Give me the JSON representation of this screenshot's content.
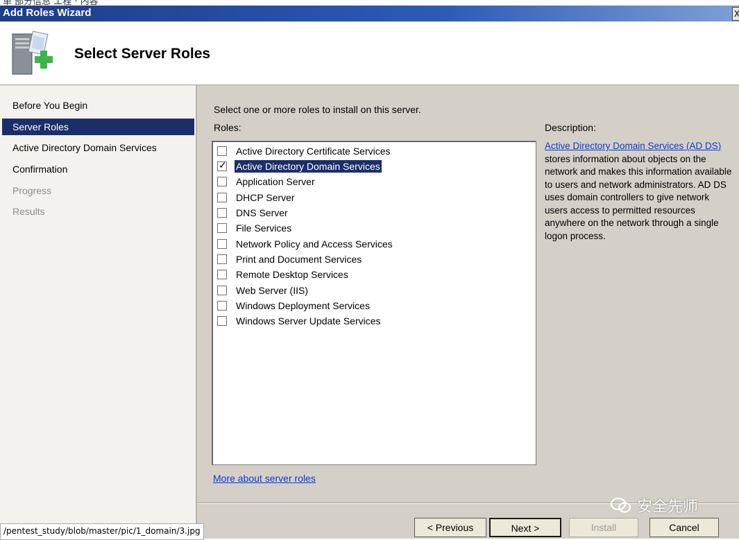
{
  "top_strip_text": "单 部分信息 工程 · 内容",
  "window": {
    "title": "Add Roles Wizard",
    "close_glyph": "X"
  },
  "header": {
    "heading": "Select Server Roles"
  },
  "nav": {
    "items": [
      {
        "label": "Before You Begin",
        "state": "normal"
      },
      {
        "label": "Server Roles",
        "state": "selected"
      },
      {
        "label": "Active Directory Domain Services",
        "state": "normal"
      },
      {
        "label": "Confirmation",
        "state": "normal"
      },
      {
        "label": "Progress",
        "state": "disabled"
      },
      {
        "label": "Results",
        "state": "disabled"
      }
    ]
  },
  "main": {
    "intro": "Select one or more roles to install on this server.",
    "roles_label": "Roles:",
    "description_label": "Description:",
    "roles": [
      {
        "label": "Active Directory Certificate Services",
        "checked": false,
        "selected": false
      },
      {
        "label": "Active Directory Domain Services",
        "checked": true,
        "selected": true
      },
      {
        "label": "Application Server",
        "checked": false,
        "selected": false
      },
      {
        "label": "DHCP Server",
        "checked": false,
        "selected": false
      },
      {
        "label": "DNS Server",
        "checked": false,
        "selected": false
      },
      {
        "label": "File Services",
        "checked": false,
        "selected": false
      },
      {
        "label": "Network Policy and Access Services",
        "checked": false,
        "selected": false
      },
      {
        "label": "Print and Document Services",
        "checked": false,
        "selected": false
      },
      {
        "label": "Remote Desktop Services",
        "checked": false,
        "selected": false
      },
      {
        "label": "Web Server (IIS)",
        "checked": false,
        "selected": false
      },
      {
        "label": "Windows Deployment Services",
        "checked": false,
        "selected": false
      },
      {
        "label": "Windows Server Update Services",
        "checked": false,
        "selected": false
      }
    ],
    "description": {
      "link_text": "Active Directory Domain Services (AD DS)",
      "body": " stores information about objects on the network and makes this information available to users and network administrators. AD DS uses domain controllers to give network users access to permitted resources anywhere on the network through a single logon process."
    },
    "more_link": "More about server roles"
  },
  "buttons": {
    "previous": "< Previous",
    "next": "Next >",
    "install": "Install",
    "cancel": "Cancel"
  },
  "watermark": "安全先师",
  "status_url": "/pentest_study/blob/master/pic/1_domain/3.jpg",
  "colors": {
    "selection": "#1c2e6a",
    "link": "#0a3bd4",
    "dialog_bg": "#d4d0c8",
    "nav_bg": "#f3f2ee",
    "title_bar": "#1c3c8c"
  }
}
